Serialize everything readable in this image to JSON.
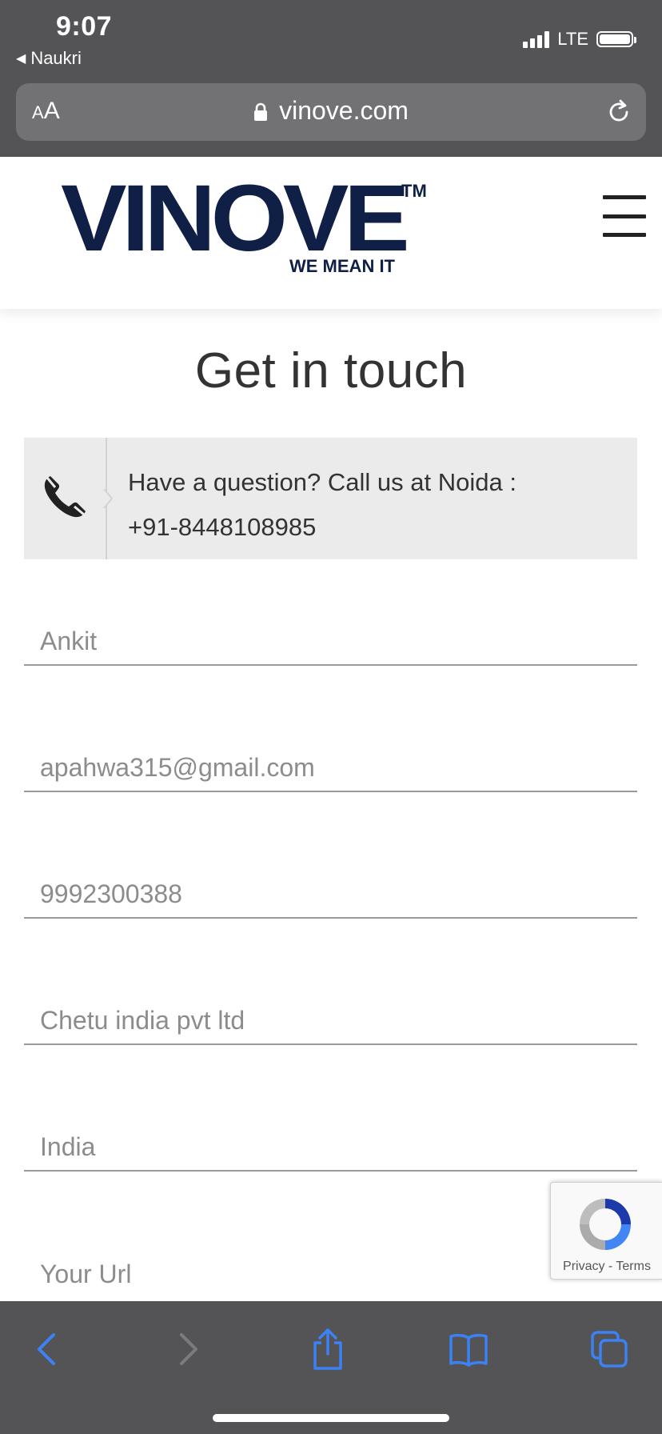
{
  "status_bar": {
    "time": "9:07",
    "back_app": "Naukri",
    "network": "LTE"
  },
  "browser": {
    "text_size_label_small": "A",
    "text_size_label_large": "A",
    "url": "vinove.com"
  },
  "site": {
    "logo_text": "VINOVE",
    "logo_tm": "TM",
    "logo_tagline": "WE MEAN IT"
  },
  "main": {
    "title": "Get in touch",
    "call_box": {
      "line1": "Have a question? Call us at Noida :",
      "line2": "+91-8448108985"
    },
    "fields": [
      {
        "placeholder": "Ankit"
      },
      {
        "placeholder": "apahwa315@gmail.com"
      },
      {
        "placeholder": "9992300388"
      },
      {
        "placeholder": "Chetu india pvt ltd"
      },
      {
        "placeholder": "India"
      },
      {
        "placeholder": "Your Url"
      }
    ]
  },
  "recaptcha": {
    "privacy": "Privacy",
    "separator": " - ",
    "terms": "Terms"
  },
  "colors": {
    "chrome": "#545456",
    "accent": "#3b82f6",
    "brand": "#0f1f45"
  },
  "toolbar": {
    "icons": [
      "back-icon",
      "forward-icon",
      "share-icon",
      "bookmarks-icon",
      "tabs-icon"
    ]
  }
}
